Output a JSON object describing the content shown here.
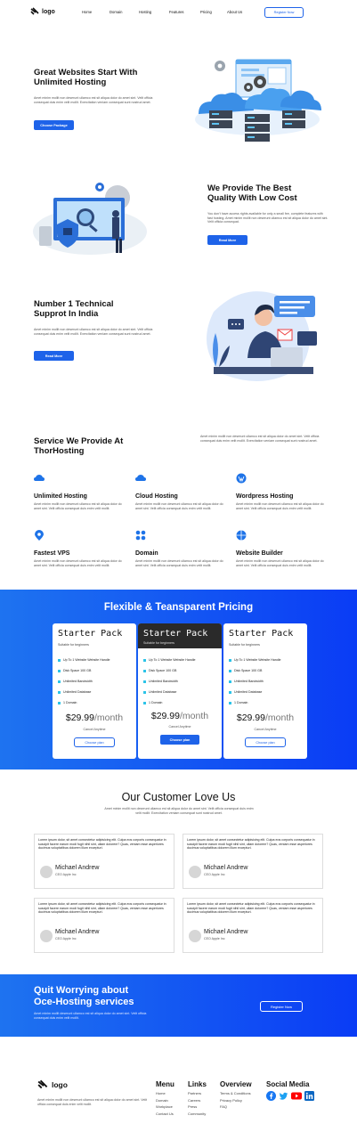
{
  "header": {
    "logo_text": "logo",
    "nav": [
      "Home",
      "Domain",
      "Hosting",
      "Features",
      "Pricing",
      "About Us"
    ],
    "register_label": "Register Now"
  },
  "hero": {
    "title_line1": "Great Websites Start With",
    "title_line2": "Unlimited Hosting",
    "body": "Amet minim mollit non deserunt ullamco est sit aliqua dolor do amet sint. Velit officia consequat duis enim velit mollit. Exercitation veniam consequat sunt nostrud amet.",
    "cta": "Choose Package"
  },
  "quality": {
    "title_line1": "We Provide The Best",
    "title_line2": "Quality With Low Cost",
    "body": "You don't have access rights available for only a small fee, complete features with fast hosting. Amet minim mollit non deserunt ullamco est sit aliqua dolor do amet sint. Velit officia consequat.",
    "cta": "Read More"
  },
  "support": {
    "title_line1": "Number 1 Technical",
    "title_line2": "Supprot In India",
    "body": "Amet minim mollit non deserunt ullamco est sit aliqua dolor do amet sint. Velit officia consequat duis enim velit mollit. Exercitation veniam consequat sunt nostrud amet.",
    "cta": "Read More"
  },
  "services": {
    "title_line1": "Service We Provide At",
    "title_line2": "ThorHosting",
    "intro": "Amet minim mollit non deserunt ullamco est sit aliqua dolor do amet sint. Velit officia consequat duis enim velit mollit. Exercitation veniam consequat sunt nostrud amet.",
    "items": [
      {
        "title": "Unlimited Hosting",
        "icon": "cloud-icon",
        "desc": "Amet minim mollit non deserunt ullamco est sit aliqua dolor do amet sint. Velit officia consequat duis enim velit mollit."
      },
      {
        "title": "Cloud Hosting",
        "icon": "cloud-icon",
        "desc": "Amet minim mollit non deserunt ullamco est sit aliqua dolor do amet sint. Velit officia consequat duis enim velit mollit."
      },
      {
        "title": "Wordpress Hosting",
        "icon": "wordpress-icon",
        "desc": "Amet minim mollit non deserunt ullamco est sit aliqua dolor do amet sint. Velit officia consequat duis enim velit mollit."
      },
      {
        "title": "Fastest VPS",
        "icon": "location-pin-icon",
        "desc": "Amet minim mollit non deserunt ullamco est sit aliqua dolor do amet sint. Velit officia consequat duis enim velit mollit."
      },
      {
        "title": "Domain",
        "icon": "grid-dots-icon",
        "desc": "Amet minim mollit non deserunt ullamco est sit aliqua dolor do amet sint. Velit officia consequat duis enim velit mollit."
      },
      {
        "title": "Website Builder",
        "icon": "globe-icon",
        "desc": "Amet minim mollit non deserunt ullamco est sit aliqua dolor do amet sint. Velit officia consequat duis enim velit mollit."
      }
    ]
  },
  "pricing": {
    "title": "Flexible & Teansparent Pricing",
    "plans": [
      {
        "name": "Starter Pack",
        "subtitle": "Suitable for beginners",
        "features": [
          "Up To 1 Website Website Handle",
          "Disk Space 100 GB",
          "Unlimited Bandwidth",
          "Unlimited Database",
          "1 Domain"
        ],
        "price": "$29.99",
        "period": "/month",
        "note": "Cancel Anytime",
        "cta": "Choose plan",
        "highlight": false
      },
      {
        "name": "Starter Pack",
        "subtitle": "Suitable for beginners",
        "features": [
          "Up To 1 Website Website Handle",
          "Disk Space 100 GB",
          "Unlimited Bandwidth",
          "Unlimited Database",
          "1 Domain"
        ],
        "price": "$29.99",
        "period": "/month",
        "note": "Cancel Anytime",
        "cta": "Choose plan",
        "highlight": true
      },
      {
        "name": "Starter Pack",
        "subtitle": "Suitable for beginners",
        "features": [
          "Up To 1 Website Website Handle",
          "Disk Space 100 GB",
          "Unlimited Bandwidth",
          "Unlimited Database",
          "1 Domain"
        ],
        "price": "$29.99",
        "period": "/month",
        "note": "Cancel Anytime",
        "cta": "Choose plan",
        "highlight": false
      }
    ]
  },
  "testimonials": {
    "title": "Our Customer Love Us",
    "intro": "Amet minim mollit non deserunt ullamco est sit aliqua dolor do amet sint. Velit officia consequat duis enim velit mollit. Exercitation veniam consequat sunt nostrud amet.",
    "items": [
      {
        "text": "Lorem ipsum dolor, sit amet consectetur adipisicing elit. Culpa eos corporis consequatur in suscipit facere earum modi fugit nihil sint, ullam dolorem? Quas, veniam esse asperiores ducimus voluptatibus dolorem illum excepturi.",
        "name": "Michael Andrew",
        "role": "CEO Apple Inc"
      },
      {
        "text": "Lorem ipsum dolor, sit amet consectetur adipisicing elit. Culpa eos corporis consequatur in suscipit facere earum modi fugit nihil sint, ullam dolorem? Quas, veniam esse asperiores ducimus voluptatibus dolorem illum excepturi.",
        "name": "Michael Andrew",
        "role": "CEO Apple Inc"
      },
      {
        "text": "Lorem ipsum dolor, sit amet consectetur adipisicing elit. Culpa eos corporis consequatur in suscipit facere earum modi fugit nihil sint, ullam dolorem? Quas, veniam esse asperiores ducimus voluptatibus dolorem illum excepturi.",
        "name": "Michael Andrew",
        "role": "CEO Apple Inc"
      },
      {
        "text": "Lorem ipsum dolor, sit amet consectetur adipisicing elit. Culpa eos corporis consequatur in suscipit facere earum modi fugit nihil sint, ullam dolorem? Quas, veniam esse asperiores ducimus voluptatibus dolorem illum excepturi.",
        "name": "Michael Andrew",
        "role": "CEO Apple Inc"
      }
    ]
  },
  "banner": {
    "title_line1": "Quit Worrying about",
    "title_line2": "Oce-Hosting services",
    "body": "Amet minim mollit deserunt ullamco est sit aliqua dolor do amet sint. Velit officia consequat duis enim velit mollit.",
    "cta": "Register Now"
  },
  "footer": {
    "logo_text": "logo",
    "about": "Amet minim mollit non deserunt ullamco est sit aliqua dolor do amet sint. Velit officia consequat duis enim velit mollit.",
    "columns": [
      {
        "title": "Menu",
        "links": [
          "Home",
          "Domain",
          "Workplace",
          "Contact Us"
        ]
      },
      {
        "title": "Links",
        "links": [
          "Partners",
          "Careers",
          "Press",
          "Community"
        ]
      },
      {
        "title": "Overview",
        "links": [
          "Terms & Conditions",
          "Privacy Policy",
          "FAQ"
        ]
      },
      {
        "title": "Social Media",
        "links": []
      }
    ],
    "social_icons": [
      "facebook-icon",
      "twitter-icon",
      "youtube-icon",
      "linkedin-icon"
    ]
  },
  "colors": {
    "primary": "#1e63e9",
    "accent": "#2cc4e8",
    "dark_card": "#2a2a2a"
  }
}
